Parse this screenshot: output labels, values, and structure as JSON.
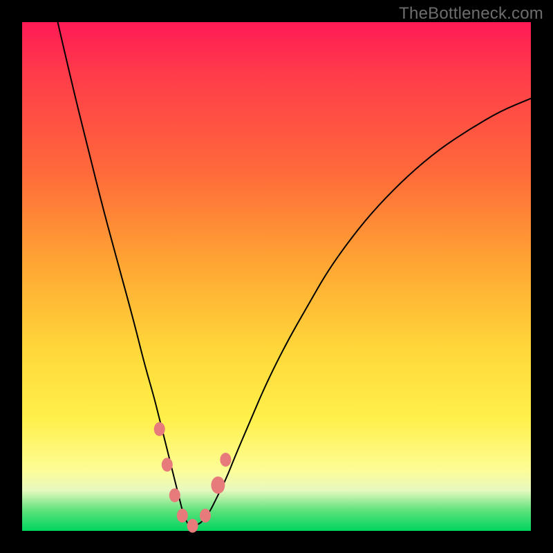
{
  "watermark": "TheBottleneck.com",
  "chart_data": {
    "type": "line",
    "title": "",
    "xlabel": "",
    "ylabel": "",
    "xlim": [
      0,
      100
    ],
    "ylim": [
      0,
      100
    ],
    "series": [
      {
        "name": "curve",
        "x": [
          7,
          10,
          13,
          16,
          19,
          22,
          24,
          26,
          27,
          28,
          29,
          30,
          30.5,
          31,
          31.5,
          32,
          32.5,
          33,
          34,
          35,
          36,
          37,
          38,
          40,
          42,
          45,
          48,
          52,
          56,
          60,
          65,
          70,
          76,
          82,
          88,
          94,
          100
        ],
        "y": [
          100,
          87,
          75,
          63,
          52,
          41,
          33,
          26,
          22,
          18,
          14,
          10,
          8,
          6,
          4,
          2.5,
          1.5,
          1,
          1,
          1.5,
          2.5,
          4,
          6,
          10,
          15,
          22,
          29,
          37,
          44,
          51,
          58,
          64,
          70,
          75,
          79,
          82.5,
          85
        ]
      }
    ],
    "markers": [
      {
        "x": 27.0,
        "y": 20,
        "r": 8
      },
      {
        "x": 28.5,
        "y": 13,
        "r": 8
      },
      {
        "x": 30.0,
        "y": 7,
        "r": 8
      },
      {
        "x": 31.5,
        "y": 3,
        "r": 8
      },
      {
        "x": 33.5,
        "y": 1,
        "r": 8
      },
      {
        "x": 36.0,
        "y": 3,
        "r": 8
      },
      {
        "x": 38.5,
        "y": 9,
        "r": 10
      },
      {
        "x": 40.0,
        "y": 14,
        "r": 8
      }
    ],
    "colors": {
      "curve_stroke": "#000000",
      "marker_fill": "#e77b7b"
    }
  }
}
